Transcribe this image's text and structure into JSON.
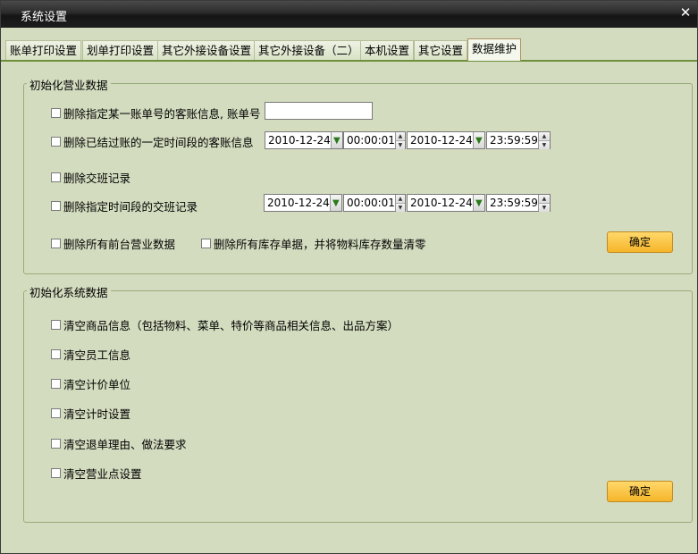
{
  "window": {
    "title": "系统设置",
    "close_glyph": "✕"
  },
  "tabs": [
    {
      "label": "账单打印设置"
    },
    {
      "label": "划单打印设置"
    },
    {
      "label": "其它外接设备设置"
    },
    {
      "label": "其它外接设备（二）"
    },
    {
      "label": "本机设置"
    },
    {
      "label": "其它设置"
    },
    {
      "label": "数据维护"
    }
  ],
  "business_group": {
    "title": "初始化营业数据",
    "delete_bill_guest": {
      "label": "删除指定某一账单号的客账信息,  账单号",
      "value": ""
    },
    "delete_settled": {
      "label": "删除已结过账的一定时间段的客账信息",
      "start_date": "2010-12-24",
      "start_time": "00:00:01",
      "end_date": "2010-12-24",
      "end_time": "23:59:59"
    },
    "delete_shift": {
      "label": "删除交班记录"
    },
    "delete_shift_range": {
      "label": "删除指定时间段的交班记录",
      "start_date": "2010-12-24",
      "start_time": "00:00:01",
      "end_date": "2010-12-24",
      "end_time": "23:59:59"
    },
    "delete_front": {
      "label": "删除所有前台营业数据"
    },
    "delete_stock": {
      "label": "删除所有库存单据，并将物料库存数量清零"
    },
    "confirm_label": "确定"
  },
  "system_group": {
    "title": "初始化系统数据",
    "items": [
      {
        "label": "清空商品信息（包括物料、菜单、特价等商品相关信息、出品方案）"
      },
      {
        "label": "清空员工信息"
      },
      {
        "label": "清空计价单位"
      },
      {
        "label": "清空计时设置"
      },
      {
        "label": "清空退单理由、做法要求"
      },
      {
        "label": "清空营业点设置"
      }
    ],
    "confirm_label": "确定"
  },
  "icons": {
    "dropdown": "chevron-down-icon",
    "spinner": "spin-up-down-icon",
    "accent": "#f6b52a"
  }
}
